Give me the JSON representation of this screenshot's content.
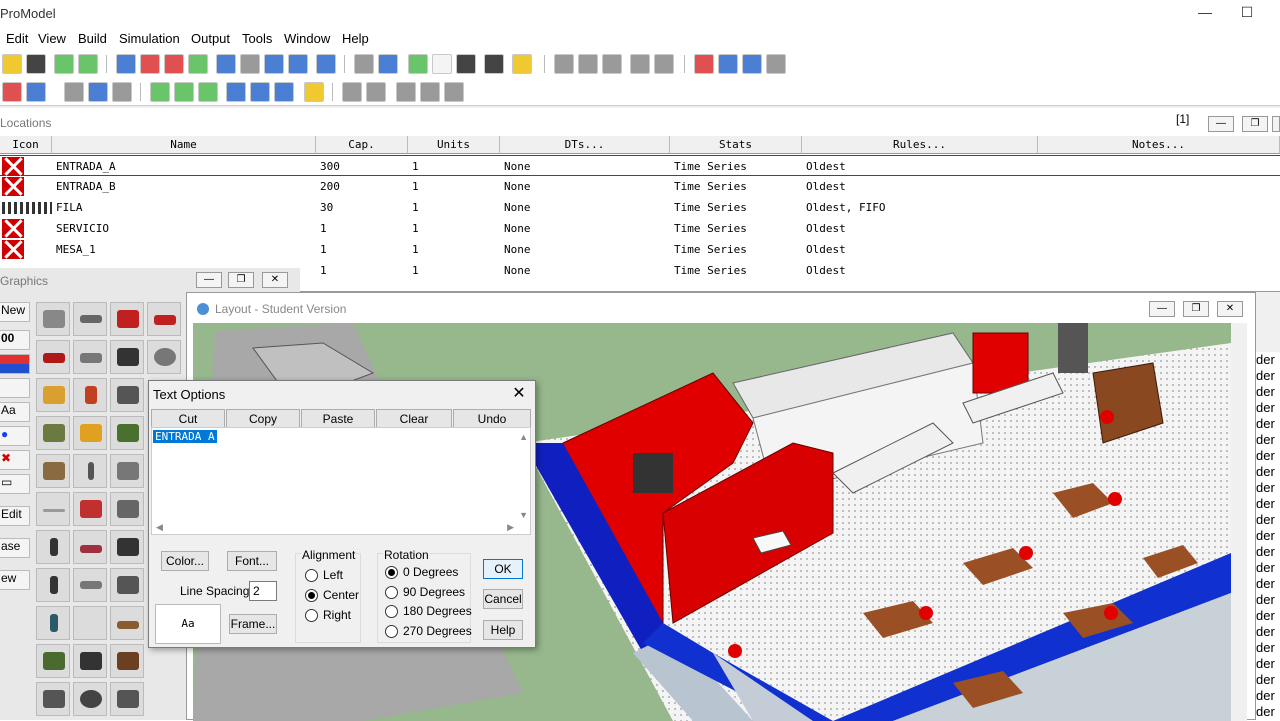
{
  "app": {
    "title": "ProModel"
  },
  "menu": [
    "Edit",
    "View",
    "Build",
    "Simulation",
    "Output",
    "Tools",
    "Window",
    "Help"
  ],
  "locations": {
    "title": "Locations",
    "index_label": "[1]",
    "columns": [
      "Icon",
      "Name",
      "Cap.",
      "Units",
      "DTs...",
      "Stats",
      "Rules...",
      "Notes..."
    ],
    "rows": [
      {
        "name": "ENTRADA_A",
        "cap": "300",
        "units": "1",
        "dts": "None",
        "stats": "Time Series",
        "rules": "Oldest",
        "notes": ""
      },
      {
        "name": "ENTRADA_B",
        "cap": "200",
        "units": "1",
        "dts": "None",
        "stats": "Time Series",
        "rules": "Oldest",
        "notes": ""
      },
      {
        "name": "FILA",
        "cap": "30",
        "units": "1",
        "dts": "None",
        "stats": "Time Series",
        "rules": "Oldest, FIFO",
        "notes": ""
      },
      {
        "name": "SERVICIO",
        "cap": "1",
        "units": "1",
        "dts": "None",
        "stats": "Time Series",
        "rules": "Oldest",
        "notes": ""
      },
      {
        "name": "MESA_1",
        "cap": "1",
        "units": "1",
        "dts": "None",
        "stats": "Time Series",
        "rules": "Oldest",
        "notes": ""
      },
      {
        "name": "",
        "cap": "1",
        "units": "1",
        "dts": "None",
        "stats": "Time Series",
        "rules": "Oldest",
        "notes": ""
      }
    ]
  },
  "graphics": {
    "title": "Graphics",
    "side_buttons": [
      "New",
      "00",
      "",
      "",
      "Aa",
      "",
      "",
      "",
      "Edit",
      "ase",
      "ew"
    ]
  },
  "layout_window": {
    "title": "Layout - Student Version"
  },
  "right_strip_text": "der",
  "text_options": {
    "title": "Text Options",
    "edit_buttons": [
      "Cut",
      "Copy",
      "Paste",
      "Clear",
      "Undo"
    ],
    "text_value": "ENTRADA A",
    "color_button": "Color...",
    "font_button": "Font...",
    "line_spacing_label": "Line Spacing:",
    "line_spacing_value": "2",
    "preview_text": "Aa",
    "frame_button": "Frame...",
    "alignment": {
      "title": "Alignment",
      "options": [
        "Left",
        "Center",
        "Right"
      ],
      "selected": "Center"
    },
    "rotation": {
      "title": "Rotation",
      "options": [
        "0 Degrees",
        "90 Degrees",
        "180 Degrees",
        "270 Degrees"
      ],
      "selected": "0 Degrees"
    },
    "ok_button": "OK",
    "cancel_button": "Cancel",
    "help_button": "Help"
  }
}
